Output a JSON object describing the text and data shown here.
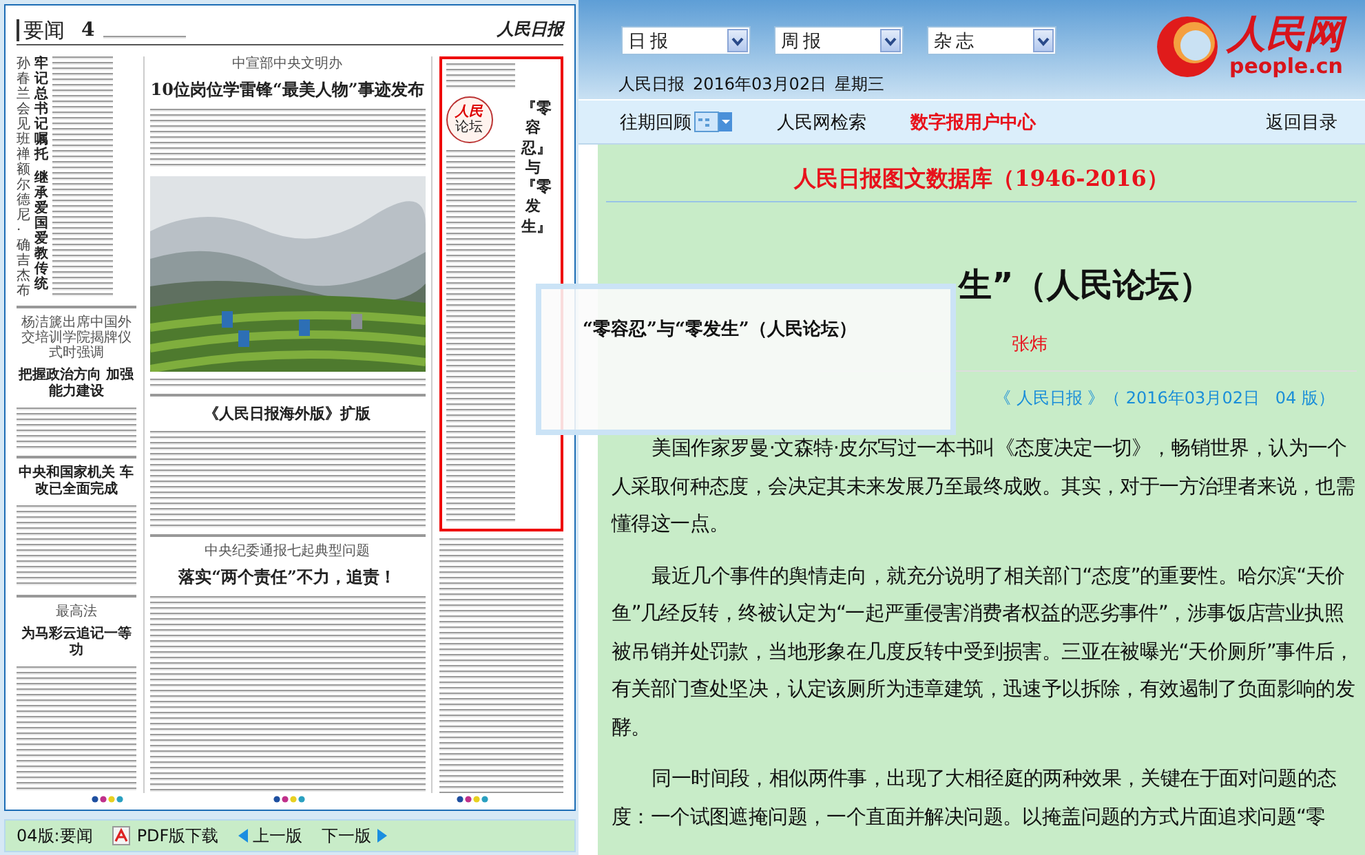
{
  "newspaper": {
    "section": "要闻",
    "page_number": "4",
    "masthead": "人民日报",
    "lead": {
      "subtitle": "孙春兰会见班禅额尔德尼·确吉杰布",
      "headline": [
        "牢记总书记嘱托",
        "继承爱国爱教传统"
      ]
    },
    "left_stories": [
      {
        "kicker": "杨洁篪出席中国外交培训学院揭牌仪式时强调",
        "headline": "把握政治方向 加强能力建设"
      },
      {
        "headline": "中央和国家机关 车改已全面完成"
      },
      {
        "kicker": "最高法",
        "headline": "为马彩云追记一等功"
      }
    ],
    "top_story": {
      "kicker": "中宣部中央文明办",
      "headline": "10位岗位学雷锋“最美人物”事迹发布"
    },
    "middle_story": {
      "headline": "《人民日报海外版》扩版"
    },
    "bottom_story": {
      "kicker": "中央纪委通报七起典型问题",
      "headline": "落实“两个责任”不力，追责！"
    },
    "forum": {
      "badge_top": "人民",
      "badge_bottom": "论坛",
      "title": "『零容忍』与『零发生』"
    }
  },
  "page_toolbar": [
    {
      "kind": "label",
      "text": "04版:要闻"
    },
    {
      "kind": "pdf",
      "text": "PDF版下载"
    },
    {
      "kind": "prev",
      "text": "上一版"
    },
    {
      "kind": "next",
      "text": "下一版"
    }
  ],
  "header": {
    "selects": [
      "日报",
      "周报",
      "杂志"
    ],
    "paper": "人民日报",
    "date": "2016年03月02日",
    "weekday": "星期三",
    "logo_text": "人民网",
    "logo_domain": "people.cn"
  },
  "nav": [
    {
      "kind": "calendar",
      "label": "往期回顾"
    },
    {
      "kind": "link",
      "label": "人民网检索"
    },
    {
      "kind": "highlight",
      "label": "数字报用户中心"
    },
    {
      "kind": "right",
      "label": "返回目录"
    }
  ],
  "article": {
    "database_title": "人民日报图文数据库（1946-2016）",
    "title": "生”（人民论坛）",
    "author": "张炜",
    "source": "《 人民日报 》（ 2016年03月02日   04 版）",
    "paragraphs": [
      "美国作家罗曼·文森特·皮尔写过一本书叫《态度决定一切》，畅销世界，认为一个人采取何种态度，会决定其未来发展乃至最终成败。其实，对于一方治理者来说，也需懂得这一点。",
      "最近几个事件的舆情走向，就充分说明了相关部门“态度”的重要性。哈尔滨“天价鱼”几经反转，终被认定为“一起严重侵害消费者权益的恶劣事件”，涉事饭店营业执照被吊销并处罚款，当地形象在几度反转中受到损害。三亚在被曝光“天价厕所”事件后，有关部门查处坚决，认定该厕所为违章建筑，迅速予以拆除，有效遏制了负面影响的发酵。",
      "同一时间段，相似两件事，出现了大相径庭的两种效果，关键在于面对问题的态度：一个试图遮掩问题，一个直面并解决问题。以掩盖问题的方式片面追求问题“零"
    ]
  },
  "tooltip": {
    "text": "“零容忍”与“零发生”（人民论坛）"
  }
}
